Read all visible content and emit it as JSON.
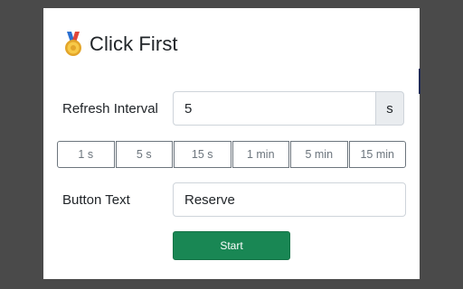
{
  "app": {
    "title": "Click First",
    "icon": "medal-icon"
  },
  "refresh": {
    "label": "Refresh Interval",
    "value": "5",
    "unit": "s",
    "presets": [
      "1 s",
      "5 s",
      "15 s",
      "1 min",
      "5 min",
      "15 min"
    ]
  },
  "button_text": {
    "label": "Button Text",
    "value": "Reserve"
  },
  "start": {
    "label": "Start"
  },
  "colors": {
    "accent": "#198754",
    "preset_border": "#6c757d",
    "addon_bg": "#e9ecef"
  }
}
